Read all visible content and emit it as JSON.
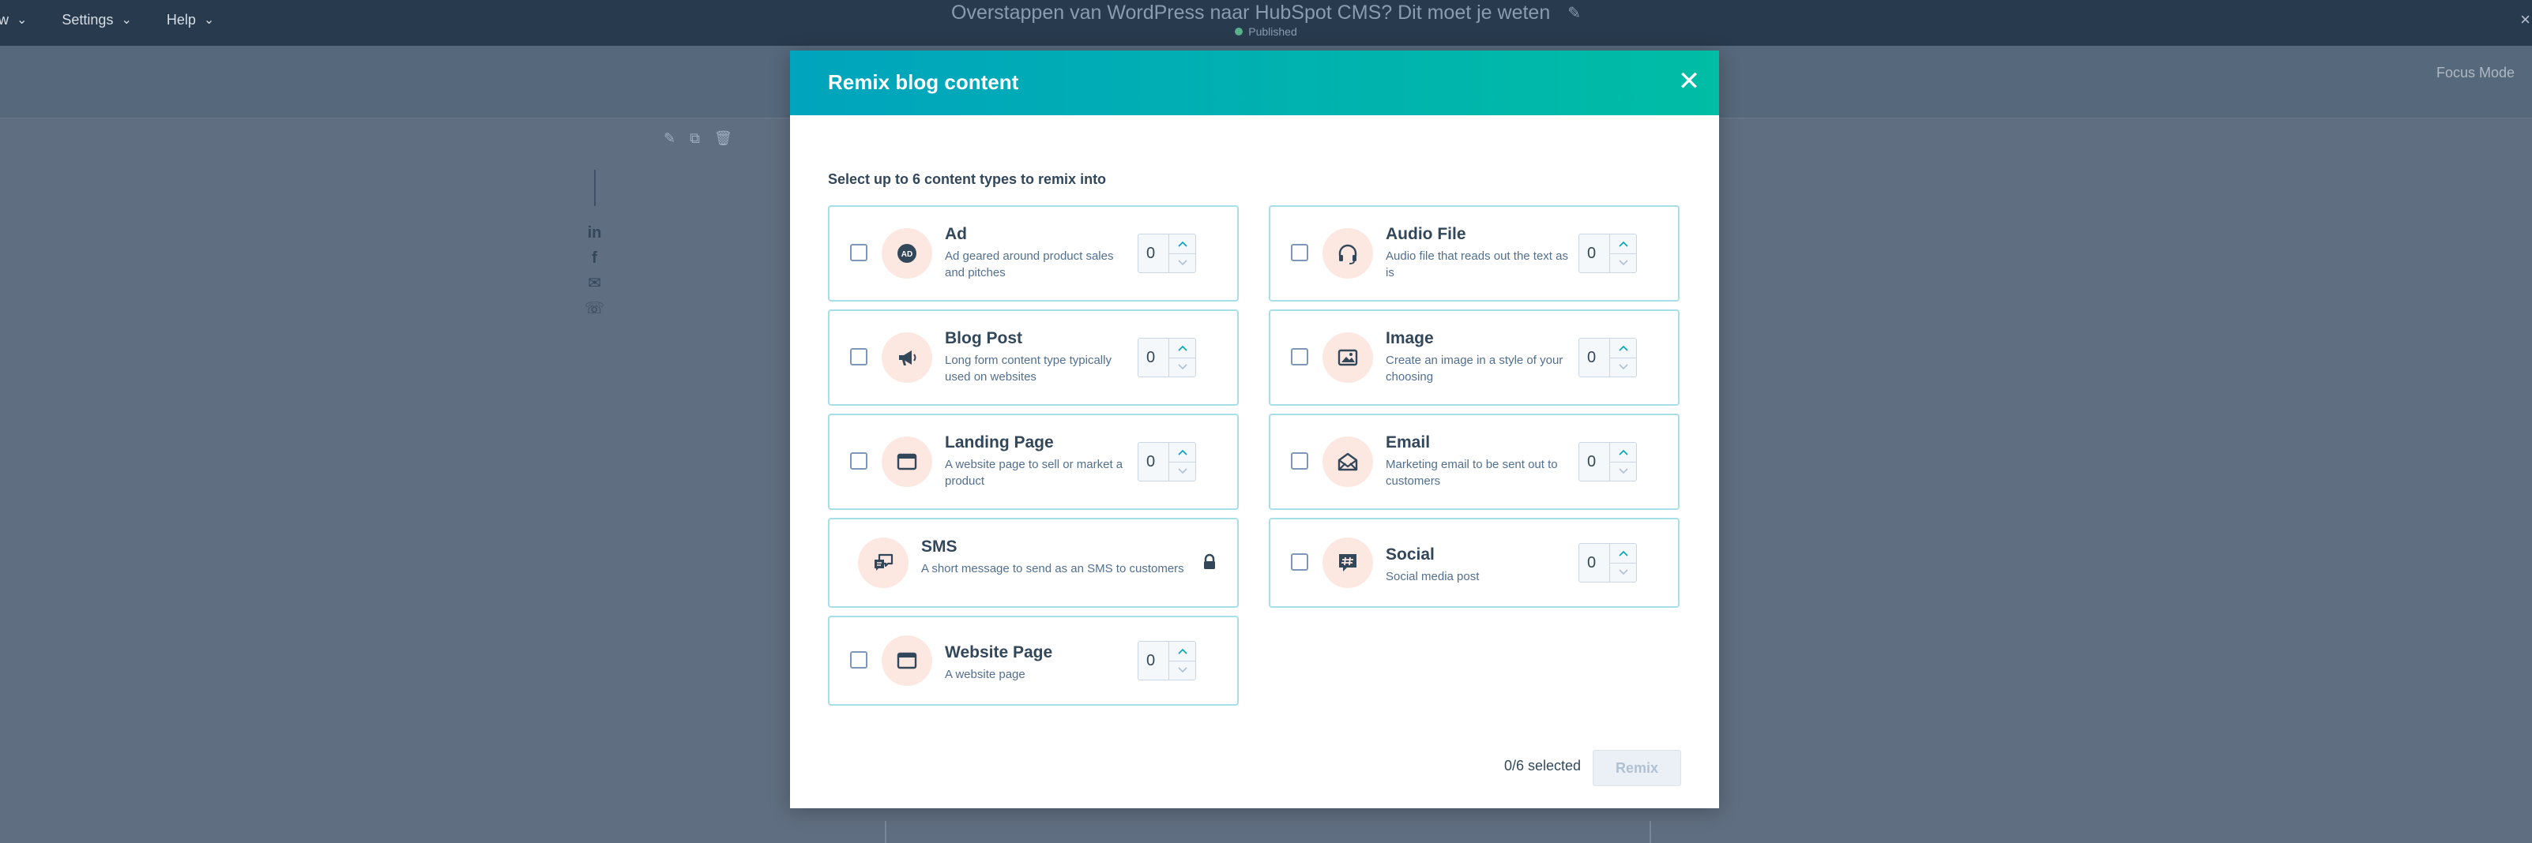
{
  "topnav": {
    "items": [
      {
        "label": "w"
      },
      {
        "label": "Settings"
      },
      {
        "label": "Help"
      }
    ]
  },
  "document": {
    "title": "Overstappen van WordPress naar HubSpot CMS? Dit moet je weten",
    "status": "Published"
  },
  "editor": {
    "focus_mode": "Focus Mode"
  },
  "modal": {
    "title": "Remix blog content",
    "instructions": "Select up to 6 content types to remix into",
    "selected_count": "0/6 selected",
    "remix_label": "Remix",
    "content_types": [
      {
        "name": "Ad",
        "desc": "Ad geared around product sales and pitches",
        "value": "0",
        "icon": "ad-icon"
      },
      {
        "name": "Audio File",
        "desc": "Audio file that reads out the text as is",
        "value": "0",
        "icon": "headphones-icon"
      },
      {
        "name": "Blog Post",
        "desc": "Long form content type typically used on websites",
        "value": "0",
        "icon": "megaphone-icon"
      },
      {
        "name": "Image",
        "desc": "Create an image in a style of your choosing",
        "value": "0",
        "icon": "image-icon"
      },
      {
        "name": "Landing Page",
        "desc": "A website page to sell or market a product",
        "value": "0",
        "icon": "browser-window-icon"
      },
      {
        "name": "Email",
        "desc": "Marketing email to be sent out to customers",
        "value": "0",
        "icon": "envelope-icon"
      },
      {
        "name": "SMS",
        "desc": "A short message to send as an SMS to customers",
        "locked": true,
        "icon": "chat-bubbles-icon"
      },
      {
        "name": "Social",
        "desc": "Social media post",
        "value": "0",
        "icon": "hashtag-icon"
      },
      {
        "name": "Website Page",
        "desc": "A website page",
        "value": "0",
        "icon": "browser-window-icon"
      }
    ]
  },
  "colors": {
    "header_gradient_start": "#00a4bd",
    "header_gradient_end": "#00bda5",
    "card_border": "#a6dfe8",
    "icon_circle": "#fde7e1",
    "text_dark": "#33475b"
  }
}
